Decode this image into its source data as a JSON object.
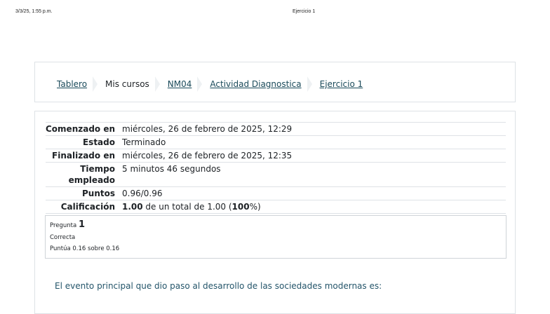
{
  "print_header": {
    "timestamp": "3/3/25, 1:55 p.m.",
    "title": "Ejercicio 1"
  },
  "breadcrumb": [
    {
      "label": "Tablero"
    },
    {
      "label": "Mis cursos"
    },
    {
      "label": "NM04"
    },
    {
      "label": "Actividad Diagnostica"
    },
    {
      "label": "Ejercicio 1"
    }
  ],
  "summary": {
    "started_label": "Comenzado en",
    "started_value": "miércoles, 26 de febrero de 2025, 12:29",
    "state_label": "Estado",
    "state_value": "Terminado",
    "finished_label": "Finalizado en",
    "finished_value": "miércoles, 26 de febrero de 2025, 12:35",
    "time_label_1": "Tiempo",
    "time_label_2": "empleado",
    "time_value": "5 minutos 46 segundos",
    "points_label": "Puntos",
    "points_value": "0.96/0.96",
    "grade_label": "Calificación",
    "grade_score": "1.00",
    "grade_mid": " de un total de 1.00 (",
    "grade_percent": "100",
    "grade_end": "%)"
  },
  "question": {
    "label": "Pregunta",
    "number": "1",
    "status": "Correcta",
    "score": "Puntúa 0.16 sobre 0.16",
    "text": "El evento principal que dio paso al desarrollo de las sociedades modernas es:"
  }
}
